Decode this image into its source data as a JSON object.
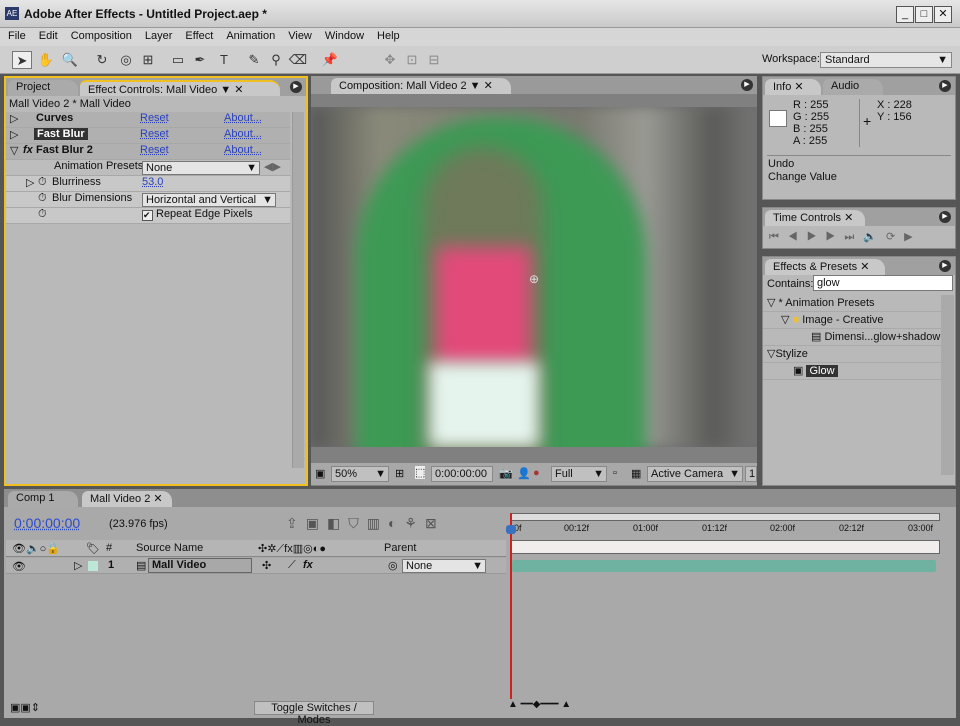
{
  "window": {
    "title": "Adobe After Effects - Untitled Project.aep *",
    "icon": "AE"
  },
  "menu": [
    "File",
    "Edit",
    "Composition",
    "Layer",
    "Effect",
    "Animation",
    "View",
    "Window",
    "Help"
  ],
  "workspace": {
    "label": "Workspace:",
    "value": "Standard"
  },
  "left_panel": {
    "tabs": [
      "Project",
      "Effect Controls: Mall Video"
    ],
    "breadcrumb": "Mall Video 2 * Mall Video",
    "effects": [
      {
        "name": "Curves",
        "reset": "Reset",
        "about": "About..."
      },
      {
        "name": "Fast Blur",
        "reset": "Reset",
        "about": "About..."
      },
      {
        "name": "Fast Blur 2",
        "reset": "Reset",
        "about": "About..."
      }
    ],
    "animation_presets": {
      "label": "Animation Presets:",
      "value": "None"
    },
    "blurriness": {
      "label": "Blurriness",
      "value": "53.0"
    },
    "blur_dimensions": {
      "label": "Blur Dimensions",
      "value": "Horizontal and Vertical"
    },
    "repeat_edge": {
      "label": "Repeat Edge Pixels",
      "checked": true
    }
  },
  "comp_panel": {
    "tab": "Composition: Mall Video 2",
    "zoom": "50%",
    "timecode": "0:00:00:00",
    "resolution": "Full",
    "camera": "Active Camera",
    "views": "1"
  },
  "info": {
    "tabs": [
      "Info",
      "Audio"
    ],
    "r": "R : 255",
    "g": "G : 255",
    "b": "B : 255",
    "a": "A : 255",
    "x": "X : 228",
    "y": "Y : 156",
    "undo": "Undo",
    "change": "Change Value"
  },
  "time_controls": {
    "tab": "Time Controls"
  },
  "effects_presets": {
    "tab": "Effects & Presets",
    "contains_label": "Contains:",
    "contains_value": "glow",
    "tree": [
      "* Animation Presets",
      "Image - Creative",
      "Dimensi...glow+shadow",
      "Stylize",
      "Glow"
    ]
  },
  "timeline": {
    "tabs": [
      "Comp 1",
      "Mall Video 2"
    ],
    "timecode": "0:00:00:00",
    "fps": "(23.976 fps)",
    "columns": {
      "num": "#",
      "source": "Source Name",
      "parent": "Parent"
    },
    "layer": {
      "index": "1",
      "name": "Mall Video",
      "parent": "None"
    },
    "ruler": [
      "0f",
      "00:12f",
      "01:00f",
      "01:12f",
      "02:00f",
      "02:12f",
      "03:00f"
    ],
    "toggle": "Toggle Switches / Modes"
  }
}
